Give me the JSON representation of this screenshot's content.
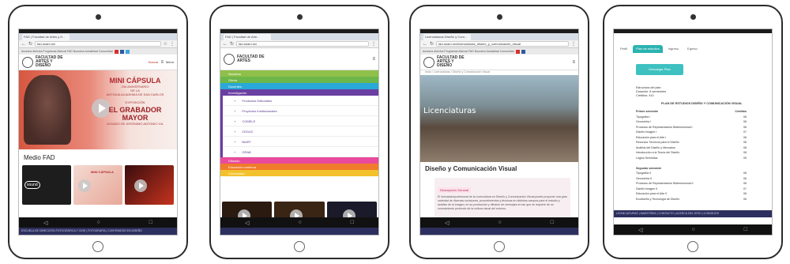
{
  "tablet1": {
    "tab_title": "FAD | Facultad de Artes y D...",
    "url": "fad.unam.mx",
    "links": "Accesos directos  Programas  Manual FAD  Nosotros  Actualidad  Comunidad",
    "logo": "FACULTAD DE ARTES Y DISEÑO",
    "search_label": "Buscar",
    "menu_label": "Menú",
    "hero_caption": "MINI CÁPSULA",
    "hero_lines": [
      "234 ANIVERSARIO",
      "DE LA",
      "ANTIGUA ACADEMIA DE SAN CARLOS"
    ],
    "hero_expo": "EXPOSICIÓN",
    "hero_big": "EL GRABADOR MAYOR",
    "hero_sub": "LEGADO DE JERÓNIMO ANTONIO GIL",
    "section_title": "Medio FAD",
    "thumb_titles": [
      "sound",
      "MINI CÁPSULA",
      ""
    ],
    "footer": "ESCUELA DE DIRECCIÓN FOTOGRÁFICA Y CINE  |  FOTOGRAFÍA  |  CONTENIDOS EN DISEÑO"
  },
  "tablet2": {
    "tab_title": "FAD | Facultad de Arte...",
    "url": "fad.unam.mx",
    "logo": "FACULTAD DE ARTES",
    "menu_items": [
      {
        "label": "Nosotros",
        "color": "#8fc04a"
      },
      {
        "label": "Oferta",
        "color": "#6db64a"
      },
      {
        "label": "Docentes",
        "color": "#29a9d8"
      },
      {
        "label": "Investigación",
        "color": "#6a3fa2"
      }
    ],
    "sub_items": [
      "Productos Editoriales",
      "Proyectos Institucionales",
      "COMELE",
      "CEDUC",
      "BIART",
      "GRAB"
    ],
    "menu_items_bottom": [
      {
        "label": "Difusión",
        "color": "#e94a9c"
      },
      {
        "label": "Educación continua",
        "color": "#f07b2a"
      },
      {
        "label": "Comunidad",
        "color": "#f3c12b"
      }
    ],
    "dots": "● ● ● ● ●"
  },
  "tablet3": {
    "tab_title": "Licenciaturas Diseño y Com...",
    "url": "fad.unam.mx/licenciaturas_diseno_y_comunicacion_visual",
    "links": "Accesos directos  Programas  Manual FAD  Nosotros  Actualidad  Comunidad",
    "logo": "FACULTAD DE ARTES Y DISEÑO",
    "breadcrumb": "Inicio  /  Licenciaturas  /  Diseño y Comunicación Visual",
    "hero_label": "Licenciaturas",
    "page_title": "Diseño y Comunicación Visual",
    "info_tag": "Descripción General",
    "info_text": "El licenciado/profesional de la Licenciatura en Diseño y Comunicación Visual puede proponer una gran variedad de diversas soluciones, procedimientos y técnicas en distintos campos para el estudio y análisis de la imagen, en su producción y difusión de mensajes en las que se requiere de un conocimiento profundo de la cultura visual del entorno."
  },
  "tablet4": {
    "tabs": [
      "Perfil",
      "Plan de estudios",
      "Ingreso",
      "Egreso"
    ],
    "button_label": "Descargar Plan",
    "meta_lines": [
      "Estructura del plan",
      "Duración: 8 semestres",
      "Créditos: 410"
    ],
    "plan_title": "PLAN DE ESTUDIOS DISEÑO Y COMUNICACIÓN VISUAL",
    "rows": [
      {
        "name": "Primer semestre",
        "value": "Créditos",
        "head": true
      },
      {
        "name": "Tipografía I",
        "value": "06"
      },
      {
        "name": "Geometría I",
        "value": "06"
      },
      {
        "name": "Procesos de Representación Bidimensional I",
        "value": "06"
      },
      {
        "name": "Diseño Imagen I",
        "value": "07"
      },
      {
        "name": "Educación para el Arte I",
        "value": "06"
      },
      {
        "name": "Recursos Técnicos para el Diseño",
        "value": "06"
      },
      {
        "name": "Análisis del Diseño y Mercados",
        "value": "08"
      },
      {
        "name": "Introducción a la Teoría del Diseño",
        "value": "06"
      },
      {
        "name": "Lógica Semiótica",
        "value": "05"
      },
      {
        "name": "",
        "value": ""
      },
      {
        "name": "Segundo semestre",
        "value": "",
        "head": true
      },
      {
        "name": "Tipografía II",
        "value": "06"
      },
      {
        "name": "Geometría II",
        "value": "06"
      },
      {
        "name": "Procesos de Representación Bidimensional II",
        "value": "06"
      },
      {
        "name": "Diseño Imagen II",
        "value": "07"
      },
      {
        "name": "Educación para el Arte II",
        "value": "06"
      },
      {
        "name": "Ecodiseño y Tecnología de Diseño",
        "value": "06"
      }
    ],
    "footer": "LICENCIATURAS  |  MAESTRÍAS  |  CONTACTO  |  ACERCA DEL SITIO  |  CONSEJOS"
  }
}
